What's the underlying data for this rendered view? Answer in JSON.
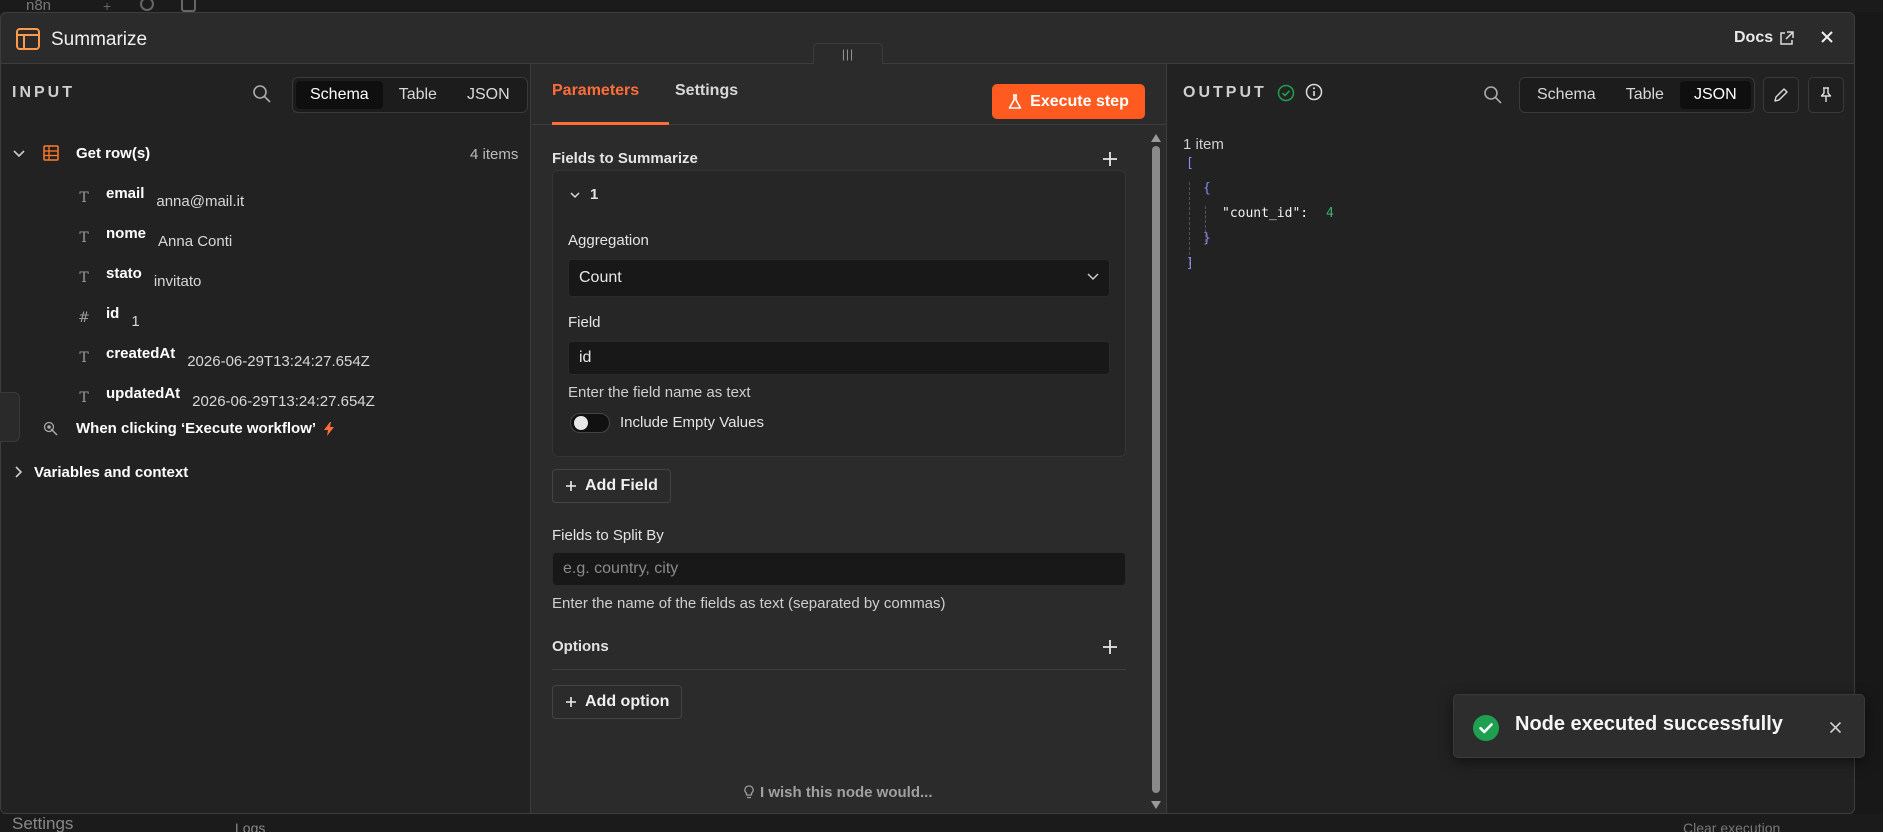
{
  "background": {
    "app_name": "n8n",
    "sidebar_settings": "Settings",
    "logs_label": "Logs",
    "clear_execution": "Clear execution"
  },
  "header": {
    "title": "Summarize",
    "docs_label": "Docs",
    "drag_handle": "|||"
  },
  "input": {
    "label": "INPUT",
    "view_tabs": [
      "Schema",
      "Table",
      "JSON"
    ],
    "active_view": "Schema",
    "source_node": "Get row(s)",
    "items_count": "4 items",
    "fields": [
      {
        "type": "T",
        "key": "email",
        "value": "anna@mail.it"
      },
      {
        "type": "T",
        "key": "nome",
        "value": "Anna Conti"
      },
      {
        "type": "T",
        "key": "stato",
        "value": "invitato"
      },
      {
        "type": "#",
        "key": "id",
        "value": "1"
      },
      {
        "type": "T",
        "key": "createdAt",
        "value": "2026-06-29T13:24:27.654Z"
      },
      {
        "type": "T",
        "key": "updatedAt",
        "value": "2026-06-29T13:24:27.654Z"
      }
    ],
    "trigger_node": "When clicking ‘Execute workflow’",
    "variables_section": "Variables and context"
  },
  "parameters": {
    "tabs": [
      "Parameters",
      "Settings"
    ],
    "active_tab": "Parameters",
    "execute_label": "Execute step",
    "fields_to_summarize_label": "Fields to Summarize",
    "item_index": "1",
    "aggregation_label": "Aggregation",
    "aggregation_value": "Count",
    "field_label": "Field",
    "field_value": "id",
    "field_hint": "Enter the field name as text",
    "include_empty_label": "Include Empty Values",
    "include_empty_on": false,
    "add_field_label": "Add Field",
    "split_by_label": "Fields to Split By",
    "split_by_placeholder": "e.g. country, city",
    "split_by_hint": "Enter the name of the fields as text (separated by commas)",
    "options_label": "Options",
    "add_option_label": "Add option",
    "wish_label": "I wish this node would..."
  },
  "output": {
    "label": "OUTPUT",
    "view_tabs": [
      "Schema",
      "Table",
      "JSON"
    ],
    "active_view": "JSON",
    "items_count": "1 item",
    "json": {
      "open_array": "[",
      "open_obj": "{",
      "key": "\"count_id\":",
      "value": "4",
      "close_obj": "}",
      "close_array": "]"
    }
  },
  "toast": {
    "message": "Node executed successfully"
  },
  "colors": {
    "accent": "#ff6d3a",
    "execute_button": "#ff5a1f",
    "success": "#1fa050",
    "json_bracket": "#8a8cf0",
    "json_number": "#39b06a"
  }
}
